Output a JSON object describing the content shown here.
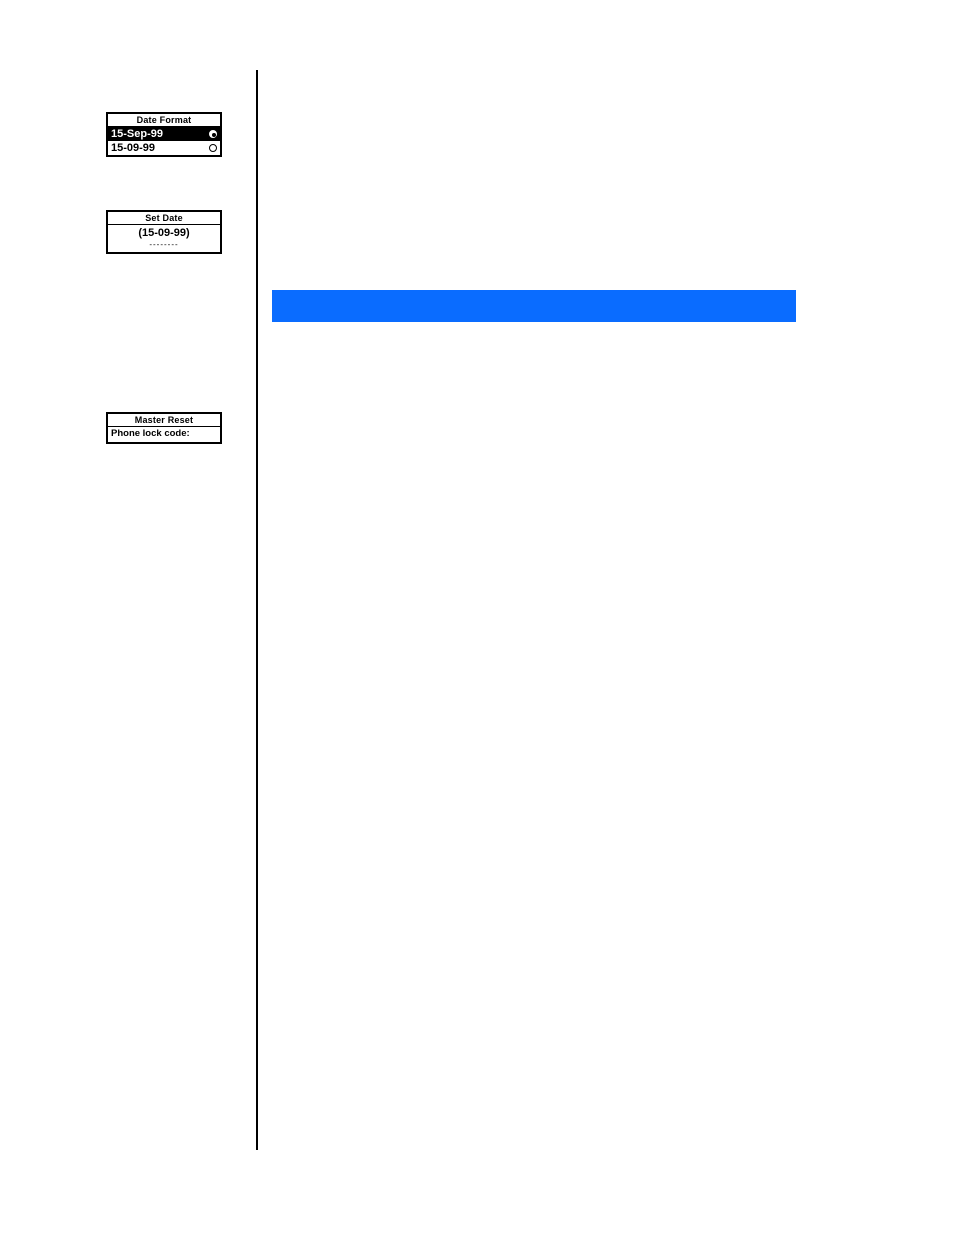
{
  "sidebar": {
    "screen1": {
      "title": "Date Format",
      "option_selected": "15-Sep-99",
      "option_other": "15-09-99"
    },
    "screen2": {
      "title": "Set Date",
      "value": "(15-09-99)",
      "dashes": "--------"
    },
    "screen3": {
      "title": "Master Reset",
      "prompt": "Phone lock code:"
    }
  },
  "bar": {
    "label": ""
  }
}
